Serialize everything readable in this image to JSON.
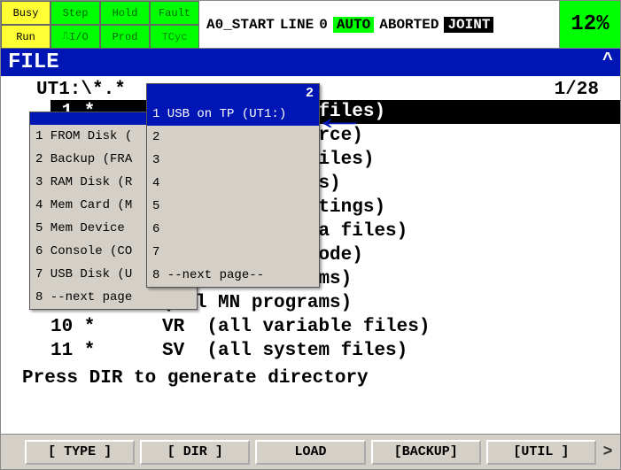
{
  "state": {
    "busy": "Busy",
    "step": "Step",
    "hold": "Hold",
    "fault": "Fault",
    "run": "Run",
    "io": "I/O",
    "prod": "Prod",
    "tcyc": "TCyc"
  },
  "status": {
    "prog": "A0_START",
    "line_lbl": "LINE",
    "line_no": "0",
    "auto": "AUTO",
    "state": "ABORTED",
    "joint": "JOINT",
    "pct": "12%"
  },
  "title": "FILE",
  "caret": "^",
  "path": "UT1:\\*.*",
  "counter": "1/28",
  "rows": [
    " 1 *               (all files)",
    " 2 * KL   (all KAREL source)",
    " 3 * CF   (all command files)",
    " 4 * TX   (all text files)",
    " 5 * LS   (all KAREL listings)",
    " 6 * DT   (all KAREL data files)",
    " 7 * PC   (all KAREL p-code)",
    " 8 * TP   (all TP programs)",
    " 9 * MN   (all MN programs)",
    "10 *      VR  (all variable files)",
    "11 *      SV  (all system files)"
  ],
  "hint": "Press DIR to generate directory",
  "menu1": {
    "items": [
      "1 FROM Disk (",
      "2 Backup (FRA",
      "3 RAM Disk (R",
      "4 Mem Card (M",
      "5 Mem Device",
      "6 Console (CO",
      "7 USB Disk (U",
      "8 --next page"
    ]
  },
  "menu2": {
    "page": "2",
    "items": [
      "1 USB on TP (UT1:)",
      "2",
      "3",
      "4",
      "5",
      "6",
      "7",
      "8 --next page--"
    ]
  },
  "fkeys": {
    "f1": "[ TYPE ]",
    "f2": "[ DIR ]",
    "f3": "LOAD",
    "f4": "[BACKUP]",
    "f5": "[UTIL ]",
    "next": ">"
  }
}
